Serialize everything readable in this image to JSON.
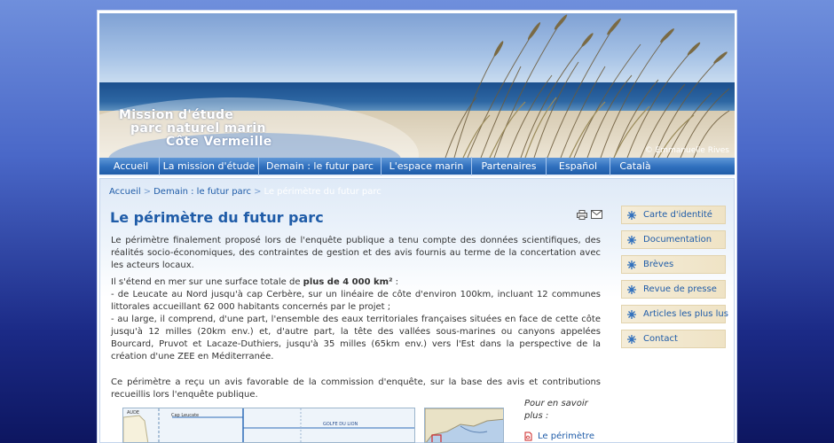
{
  "banner": {
    "title_line1": "Mission d'étude",
    "title_line2": "parc naturel marin",
    "title_line3": "Côte Vermeille",
    "credit": "© Emmanuelle Rives"
  },
  "nav": {
    "items": [
      {
        "label": "Accueil"
      },
      {
        "label": "La mission d'étude"
      },
      {
        "label": "Demain : le futur parc"
      },
      {
        "label": "L'espace marin"
      },
      {
        "label": "Partenaires"
      },
      {
        "label": "Español"
      },
      {
        "label": "Català"
      }
    ]
  },
  "breadcrumb": {
    "home": "Accueil",
    "section": "Demain : le futur parc",
    "current": "Le périmètre du futur parc",
    "separator": ">"
  },
  "article": {
    "title": "Le périmètre du futur parc",
    "p1": "Le périmètre finalement proposé lors de l'enquête publique a tenu compte des données scientifiques, des réalités socio-économiques, des contraintes de gestion et des avis fournis au terme de la concertation avec les acteurs locaux.",
    "p2_prefix": "Il s'étend en mer sur une surface totale de ",
    "p2_bold": "plus de 4 000 km²",
    "p2_suffix": " :",
    "p2_line2": "- de Leucate au Nord jusqu'à cap Cerbère, sur un linéaire de côte d'environ 100km, incluant 12 communes littorales accueillant 62 000 habitants concernés par le projet ;",
    "p2_line3": "- au large, il comprend, d'une part, l'ensemble des eaux territoriales françaises situées en face de cette côte jusqu'à 12 milles (20km env.) et, d'autre part, la tête des vallées sous-marines ou canyons appelées Bourcard, Pruvot et Lacaze-Duthiers, jusqu'à 35 milles (65km env.) vers l'Est dans la perspective de la création d'une ZEE en Méditerranée.",
    "p3": "Ce périmètre a reçu un avis favorable de la commission d'enquête, sur la base des avis et contributions recueillis lors l'enquête publique.",
    "more_title": "Pour en savoir plus :",
    "more_link": "Le périmètre"
  },
  "map": {
    "label_aude": "AUDE",
    "label_leucate": "Cap Leucate",
    "label_golfe": "GOLFE DU LION"
  },
  "sidebar": {
    "items": [
      {
        "label": "Carte d'identité"
      },
      {
        "label": "Documentation"
      },
      {
        "label": "Brèves"
      },
      {
        "label": "Revue de presse"
      },
      {
        "label": "Articles les plus lus"
      },
      {
        "label": "Contact"
      }
    ]
  },
  "colors": {
    "link_blue": "#1f5ca8",
    "nav_blue": "#2f6fbd",
    "sidebar_bg": "#f4ecd8"
  },
  "icons": {
    "print": "printer-icon",
    "mail": "envelope-icon",
    "sidebar": "star-icon",
    "pdf": "pdf-icon"
  }
}
